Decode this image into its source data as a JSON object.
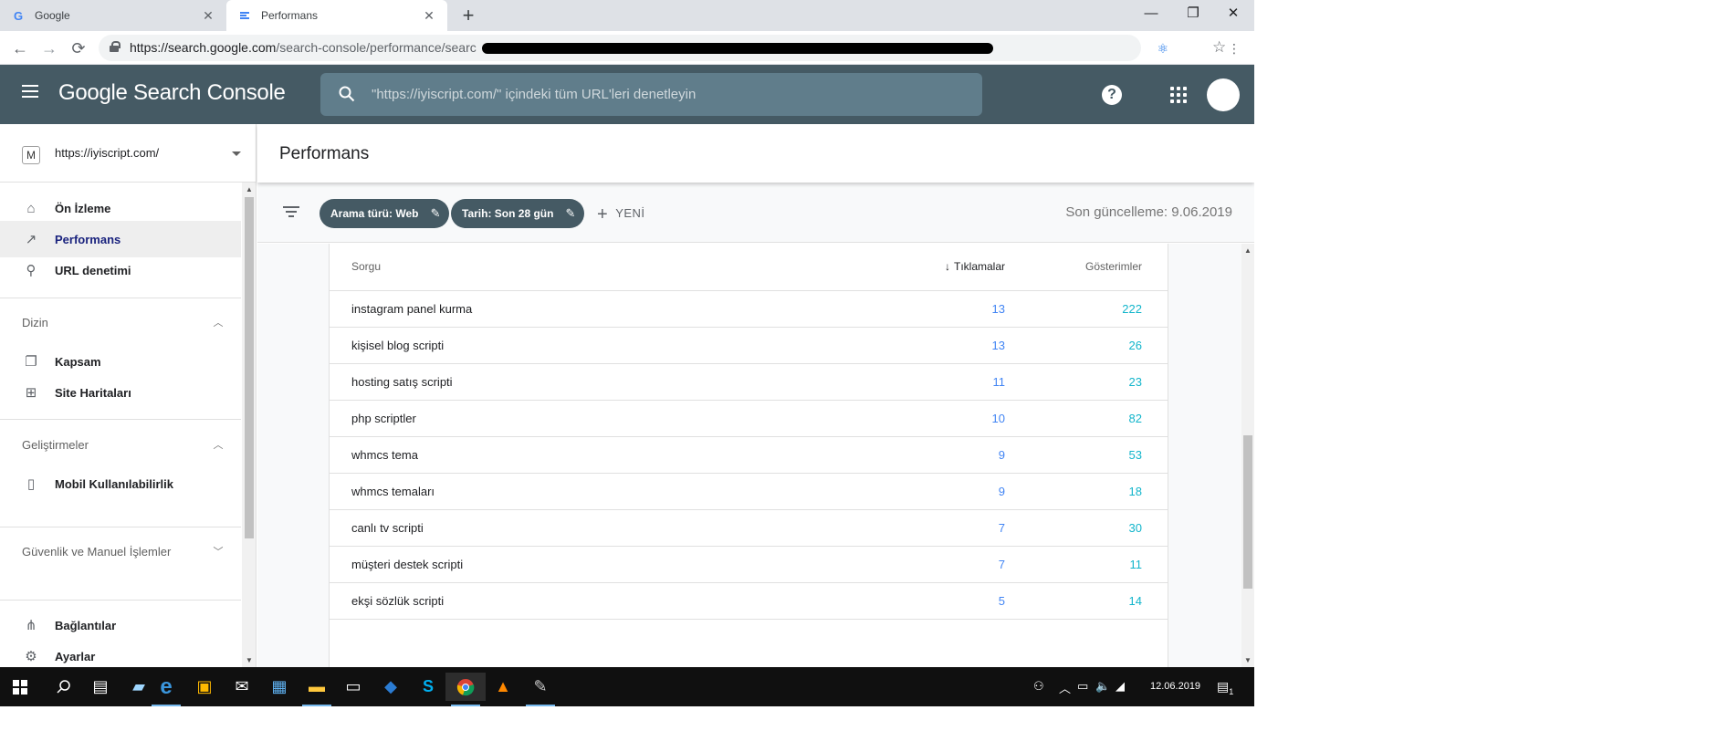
{
  "browser": {
    "tabs": [
      {
        "title": "Google",
        "favicon": "google-g-icon"
      },
      {
        "title": "Performans",
        "favicon": "search-console-icon"
      }
    ],
    "url_host": "https://search.google.com",
    "url_path": "/search-console/performance/searc"
  },
  "header": {
    "brand": "Google Search Console",
    "search_placeholder": "\"https://iyiscript.com/\" içindeki tüm URL'leri denetleyin",
    "help_label": "?"
  },
  "sidebar": {
    "property": "https://iyiscript.com/",
    "property_icon_label": "M",
    "items_top": [
      {
        "label": "Ön İzleme",
        "icon": "home-icon",
        "selected": false
      },
      {
        "label": "Performans",
        "icon": "trending-up-icon",
        "selected": true
      },
      {
        "label": "URL denetimi",
        "icon": "search-icon",
        "selected": false
      }
    ],
    "section_dizin": "Dizin",
    "items_dizin": [
      {
        "label": "Kapsam",
        "icon": "copy-icon"
      },
      {
        "label": "Site Haritaları",
        "icon": "sitemap-icon"
      }
    ],
    "section_gelistirmeler": "Geliştirmeler",
    "items_gelistirmeler": [
      {
        "label": "Mobil Kullanılabilirlik",
        "icon": "phone-icon"
      }
    ],
    "section_guvenlik": "Güvenlik ve Manuel İşlemler",
    "items_bottom": [
      {
        "label": "Bağlantılar",
        "icon": "links-icon"
      },
      {
        "label": "Ayarlar",
        "icon": "gear-icon"
      }
    ]
  },
  "page": {
    "title": "Performans",
    "chips": [
      "Arama türü: Web",
      "Tarih: Son 28 gün"
    ],
    "new_label": "YENİ",
    "last_updated": "Son güncelleme: 9.06.2019"
  },
  "table": {
    "columns": [
      "Sorgu",
      "Tıklamalar",
      "Gösterimler"
    ],
    "rows": [
      {
        "query": "instagram panel kurma",
        "clicks": "13",
        "impressions": "222"
      },
      {
        "query": "kişisel blog scripti",
        "clicks": "13",
        "impressions": "26"
      },
      {
        "query": "hosting satış scripti",
        "clicks": "11",
        "impressions": "23"
      },
      {
        "query": "php scriptler",
        "clicks": "10",
        "impressions": "82"
      },
      {
        "query": "whmcs tema",
        "clicks": "9",
        "impressions": "53"
      },
      {
        "query": "whmcs temaları",
        "clicks": "9",
        "impressions": "18"
      },
      {
        "query": "canlı tv scripti",
        "clicks": "7",
        "impressions": "30"
      },
      {
        "query": "müşteri destek scripti",
        "clicks": "7",
        "impressions": "11"
      },
      {
        "query": "ekşi sözlük scripti",
        "clicks": "5",
        "impressions": "14"
      }
    ]
  },
  "taskbar": {
    "date": "12.06.2019",
    "notification_count": "1"
  },
  "colors": {
    "appbar": "#455a64",
    "clicks": "#4285f4",
    "impressions": "#12b5cb"
  }
}
